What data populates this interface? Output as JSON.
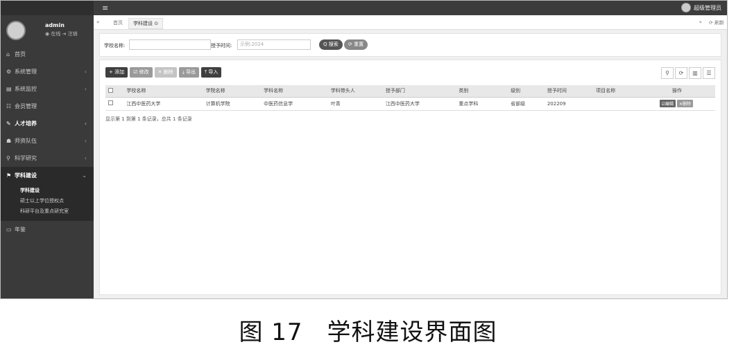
{
  "topbar": {
    "menu_icon": "≡",
    "user_label": "超级管理员"
  },
  "sidebar": {
    "user": {
      "name": "admin",
      "status": "◉ 在线 ⇥ 注销"
    },
    "items": [
      {
        "icon": "⌂",
        "label": "首页"
      },
      {
        "icon": "⚙",
        "label": "系统管理"
      },
      {
        "icon": "▤",
        "label": "系统监控"
      },
      {
        "icon": "☷",
        "label": "会员管理"
      },
      {
        "icon": "✎",
        "label": "人才培养"
      },
      {
        "icon": "☗",
        "label": "师资队伍"
      },
      {
        "icon": "⚲",
        "label": "科学研究"
      },
      {
        "icon": "⚑",
        "label": "学科建设"
      },
      {
        "icon": "▭",
        "label": "年鉴"
      }
    ],
    "subitems": [
      "学科建设",
      "硕士以上学位授权点",
      "科研平台及重点研究室"
    ]
  },
  "tabs": {
    "home": "首页",
    "current": "学科建设 ⊙",
    "right_tools": [
      "»",
      "⟳ 刷新"
    ]
  },
  "search": {
    "school_label": "学校名称:",
    "time_label": "授予时间:",
    "time_placeholder": "示例:2024",
    "search_btn": "Q 搜索",
    "reset_btn": "⟳ 重置"
  },
  "toolbar": {
    "add": "+ 添加",
    "edit": "☑ 修改",
    "delete": "✕ 删除",
    "export": "⤓ 导出",
    "import": "⤒ 导入"
  },
  "table": {
    "headers": [
      "学校名称",
      "学院名称",
      "学科名称",
      "学科带头人",
      "授予部门",
      "类别",
      "级别",
      "授予时间",
      "项目名称",
      "操作"
    ],
    "rows": [
      {
        "school": "江西中医药大学",
        "college": "计算机学院",
        "discipline": "中医药信息学",
        "leader": "叶青",
        "dept": "江西中医药大学",
        "category": "重点学科",
        "level": "省部级",
        "time": "202209",
        "project": "",
        "edit": "☑编辑",
        "delete": "✕删除"
      }
    ],
    "footer": "显示第 1 到第 1 条记录，总共 1 条记录"
  },
  "caption": "图 17　学科建设界面图"
}
